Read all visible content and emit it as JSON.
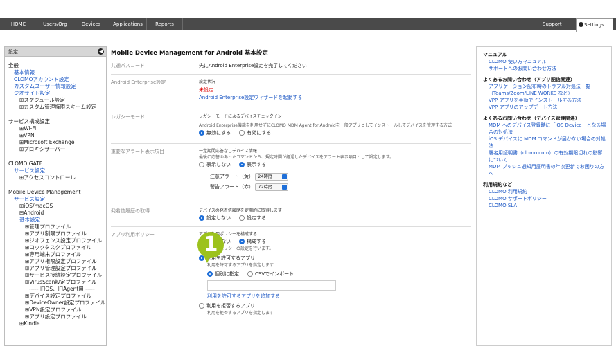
{
  "nav": {
    "items": [
      "HOME",
      "Users/Org",
      "Devices",
      "Applications",
      "Reports"
    ],
    "support": "Support",
    "settings": "Settings"
  },
  "sidebar": {
    "header": "設定",
    "collapse_glyph": "◀",
    "general": {
      "title": "全般",
      "items": [
        "基本情報",
        "CLOMOアカウント設定",
        "カスタムユーザー情報設定",
        "ジオサイト設定"
      ],
      "expandables": [
        "スケジュール設定",
        "カスタム管理権限スキーム設定"
      ]
    },
    "service": {
      "title": "サービス構成設定",
      "items": [
        "Wi-Fi",
        "VPN",
        "Microsoft Exchange",
        "プロキシサーバー"
      ]
    },
    "gate": {
      "title": "CLOMO GATE",
      "link": "サービス設定",
      "expandable": "アクセスコントロール"
    },
    "mdm": {
      "title": "Mobile Device Management",
      "link": "サービス設定",
      "ios": "iOS/macOS",
      "android": "Android",
      "android_base": "基本設定",
      "profiles": [
        "管理プロファイル",
        "アプリ制限プロファイル",
        "ジオフェンス設定プロファイル",
        "ロックタスクプロファイル",
        "専用端末プロファイル",
        "アプリ権限設定プロファイル",
        "アプリ管理設定プロファイル",
        "サービス接続設定プロファイル",
        "VirusScan設定プロファイル"
      ],
      "divider": "----- 旧OS、旧Agent用 -----",
      "legacy_profiles": [
        "デバイス設定プロファイル",
        "DeviceOwner設定プロファイル",
        "VPN設定プロファイル",
        "アプリ設定プロファイル"
      ],
      "kindle": "Kindle"
    }
  },
  "main": {
    "title": "Mobile Device Management for Android 基本設定",
    "rows": {
      "passcode": {
        "label": "共通パスコード",
        "text": "先にAndroid Enterprise設定を完了してください"
      },
      "enterprise": {
        "label": "Android Enterprise設定",
        "status_label": "設定状況",
        "status": "未設定",
        "link": "Android Enterprise設定ウィザードを起動する"
      },
      "legacy": {
        "label": "レガシーモード",
        "subtitle": "レガシーモードによるデバイスチェックイン",
        "desc": "Android Enterprise機能を利用せずにCLOMO MDM Agent for Androidを一般アプリとしてインストールしてデバイスを管理する方式",
        "opt_off": "無効にする",
        "opt_on": "有効にする"
      },
      "alert": {
        "label": "重要なアラート表示項目",
        "subtitle": "一定期間応答なしデバイス情報",
        "desc": "最後に応答のあったコマンドから、規定時間が経過したデバイスをアラート表示項目として設定します。",
        "opt_hide": "表示しない",
        "opt_show": "表示する",
        "warn_yellow": "注意アラート（黄）",
        "warn_yellow_value": "24時間",
        "warn_red": "警告アラート（赤）",
        "warn_red_value": "72時間"
      },
      "history": {
        "label": "発着信履歴の取得",
        "subtitle": "デバイスの発着信履歴を定期的に取得します",
        "opt_off": "設定しない",
        "opt_on": "設定する"
      },
      "policy": {
        "label": "アプリ利用ポリシー",
        "subtitle": "アプリ利用ポリシーを構成する",
        "opt_off": "構成しない",
        "opt_on": "構成する",
        "desc": "アプリ利用ポリシーの設定を行います。",
        "allow_title": "利用を許可するアプリ",
        "allow_desc": "利用を許可するアプリを指定します",
        "opt_individual": "個別に指定",
        "opt_csv": "CSVでインポート",
        "add_link": "利用を許可するアプリを追加する",
        "deny_title": "利用を拒否するアプリ",
        "deny_desc": "利用を拒否するアプリを指定します"
      }
    }
  },
  "marker": {
    "number": "1",
    "color": "#9cc21d"
  },
  "right": {
    "manual": {
      "title": "マニュアル",
      "links": [
        "CLOMO 使い方マニュアル",
        "サポートへのお問い合わせ方法"
      ]
    },
    "faq_app": {
      "title": "よくあるお問い合わせ（アプリ配信関連）",
      "links": [
        "アプリケーション配布時のトラブル対処法一覧（Teams/Zoom/LINE WORKS など）",
        "VPP アプリを手動でインストールする方法",
        "VPP アプリのアップデート方法"
      ]
    },
    "faq_device": {
      "title": "よくあるお問い合わせ（デバイス管理関連）",
      "links": [
        "MDM へのデバイス登録時に「iOS Device」となる場合の対処法",
        "iOS デバイスに MDM コマンドが届かない場合の対処法",
        "署名用証明書（clomo.com）の有効期限切れの影響について",
        "MDM プッシュ通知用証明書の年次更新でお困りの方へ"
      ]
    },
    "terms": {
      "title": "利用規約など",
      "links": [
        "CLOMO 利用規約",
        "CLOMO サポートポリシー",
        "CLOMO SLA"
      ]
    }
  }
}
